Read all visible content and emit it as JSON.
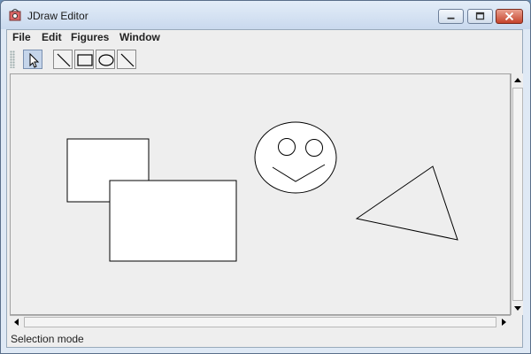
{
  "window": {
    "title": "JDraw Editor"
  },
  "menu": [
    "File",
    "Edit",
    "Figures",
    "Window"
  ],
  "toolbar": {
    "tools": [
      {
        "icon": "arrow-pointer-icon",
        "selected": true
      },
      {
        "icon": "line-tool-icon",
        "selected": false
      },
      {
        "icon": "rectangle-tool-icon",
        "selected": false
      },
      {
        "icon": "oval-tool-icon",
        "selected": false
      },
      {
        "icon": "line-tool-icon",
        "selected": false
      }
    ]
  },
  "status": {
    "text": "Selection mode"
  },
  "colors": {
    "title_bar": "#c9d9ee",
    "close_button": "#c6442c",
    "canvas_background": "#eeeeee",
    "shape_fill": "#ffffff",
    "shape_stroke": "#000000"
  }
}
